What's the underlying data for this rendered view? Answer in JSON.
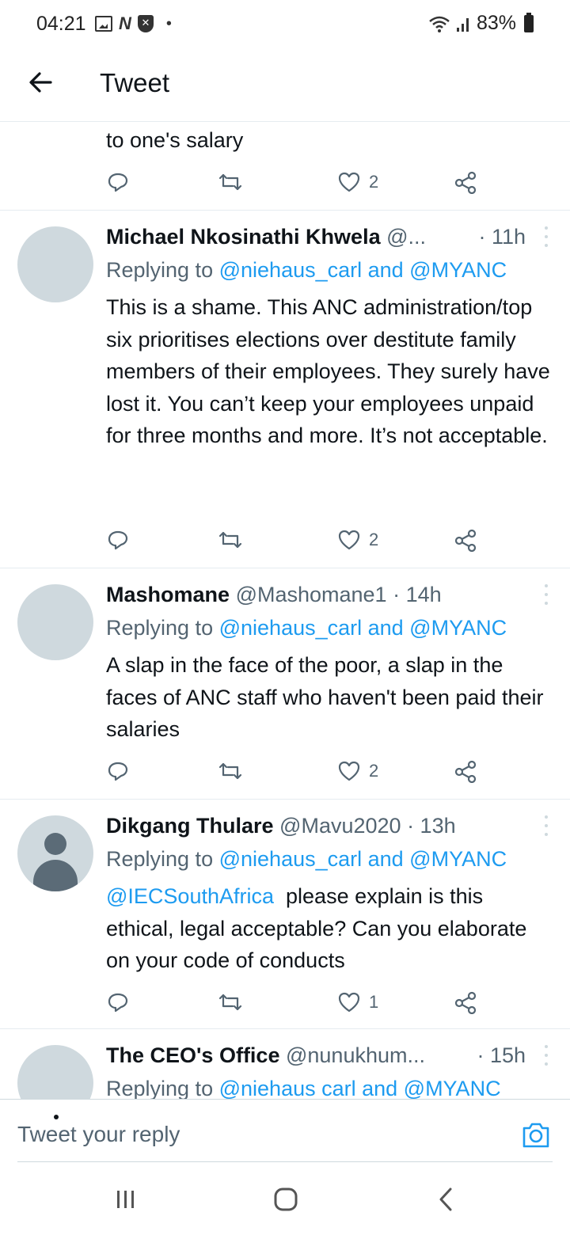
{
  "status_bar": {
    "time": "04:21",
    "battery": "83%",
    "icons": [
      "gallery-icon",
      "n-icon",
      "shield-icon",
      "dot-icon",
      "wifi-icon",
      "signal-icon",
      "battery-icon"
    ]
  },
  "header": {
    "title": "Tweet"
  },
  "partial_tweet": {
    "text": "to one's salary",
    "likes": "2"
  },
  "tweets": [
    {
      "name": "Michael Nkosinathi Khwela",
      "handle": "@...",
      "time": "· 11h",
      "replying_prefix": "Replying to",
      "replying_mentions": "@niehaus_carl and @MYANC",
      "text": "This is a shame. This ANC administration/top six prioritises elections over destitute family members of their employees. They surely have lost it. You can’t keep your employees unpaid for three months and more. It’s not acceptable.",
      "likes": "2"
    },
    {
      "name": "Mashomane",
      "handle": "@Mashomane1",
      "time": "· 14h",
      "replying_prefix": "Replying to",
      "replying_mentions": "@niehaus_carl and @MYANC",
      "text": "A slap in the face of the poor, a slap in the faces of ANC staff who haven't been paid their salaries",
      "likes": "2"
    },
    {
      "name": "Dikgang Thulare",
      "handle": "@Mavu2020",
      "time": "· 13h",
      "replying_prefix": "Replying to",
      "replying_mentions": "@niehaus_carl and @MYANC",
      "text_mention": "@IECSouthAfrica",
      "text": "please explain is this ethical, legal acceptable?  Can you elaborate on your code of conducts",
      "likes": "1"
    },
    {
      "name": "The CEO's Office",
      "handle": "@nunukhum...",
      "time": "· 15h",
      "replying_prefix": "Replying to",
      "replying_mentions": "@niehaus carl and @MYANC"
    }
  ],
  "reply_bar": {
    "placeholder": "Tweet your reply"
  },
  "colors": {
    "accent": "#1d9bf0",
    "secondary_text": "#536471",
    "avatar_bg": "#cfd9de"
  }
}
